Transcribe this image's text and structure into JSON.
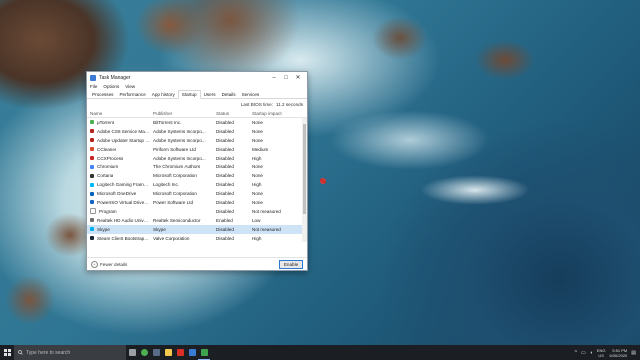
{
  "task_manager": {
    "title": "Task Manager",
    "menu": [
      "File",
      "Options",
      "View"
    ],
    "tabs": [
      "Processes",
      "Performance",
      "App history",
      "Startup",
      "Users",
      "Details",
      "Services"
    ],
    "active_tab": "Startup",
    "bios_label": "Last BIOS time:",
    "bios_value": "11.2 seconds",
    "columns": {
      "name": "Name",
      "publisher": "Publisher",
      "status": "Status",
      "impact": "Startup impact"
    },
    "rows": [
      {
        "name": "µTorrent",
        "publisher": "BitTorrent Inc.",
        "status": "Disabled",
        "impact": "None",
        "icon_color": "#4caf50"
      },
      {
        "name": "Adobe CS6 Service Manager",
        "publisher": "Adobe Systems Incorpo...",
        "status": "Disabled",
        "impact": "None",
        "icon_color": "#b3261e"
      },
      {
        "name": "Adobe Updater Startup Utility",
        "publisher": "Adobe Systems Incorpo...",
        "status": "Disabled",
        "impact": "None",
        "icon_color": "#b3261e"
      },
      {
        "name": "CCleaner",
        "publisher": "Piriform Software Ltd",
        "status": "Disabled",
        "impact": "Medium",
        "icon_color": "#d64b2c"
      },
      {
        "name": "CCXProcess",
        "publisher": "Adobe Systems Incorpo...",
        "status": "Disabled",
        "impact": "High",
        "icon_color": "#c62828"
      },
      {
        "name": "Chromium",
        "publisher": "The Chromium Authors",
        "status": "Disabled",
        "impact": "None",
        "icon_color": "#4285f4"
      },
      {
        "name": "Cortana",
        "publisher": "Microsoft Corporation",
        "status": "Disabled",
        "impact": "None",
        "icon_color": "#333333"
      },
      {
        "name": "Logitech Gaming Framework",
        "publisher": "Logitech Inc.",
        "status": "Disabled",
        "impact": "High",
        "icon_color": "#00b8fc"
      },
      {
        "name": "Microsoft OneDrive",
        "publisher": "Microsoft Corporation",
        "status": "Disabled",
        "impact": "None",
        "icon_color": "#0364b8"
      },
      {
        "name": "PowerISO Virtual Drive Man...",
        "publisher": "Power Software Ltd",
        "status": "Disabled",
        "impact": "None",
        "icon_color": "#1565c0"
      },
      {
        "name": "Program",
        "publisher": "",
        "status": "Disabled",
        "impact": "Not measured",
        "icon_color": "#ffffff"
      },
      {
        "name": "Realtek HD Audio Universal ...",
        "publisher": "Realtek Semiconductor",
        "status": "Enabled",
        "impact": "Low",
        "icon_color": "#6d6d6d"
      },
      {
        "name": "Skype",
        "publisher": "Skype",
        "status": "Disabled",
        "impact": "Not measured",
        "icon_color": "#00aff0"
      },
      {
        "name": "Steam Client Bootstrapper",
        "publisher": "Valve Corporation",
        "status": "Disabled",
        "impact": "High",
        "icon_color": "#1b2838"
      }
    ],
    "selected_row": "Skype",
    "fewer_details": "Fewer details",
    "enable_button": "Enable"
  },
  "taskbar": {
    "search_placeholder": "Type here to search",
    "pinned": [
      {
        "name": "task-view-icon",
        "color": "#9aa0a6"
      },
      {
        "name": "chrome-icon",
        "color": "#4caf50"
      },
      {
        "name": "steam-icon",
        "color": "#5a6b85"
      },
      {
        "name": "file-explorer-icon",
        "color": "#f2c94c"
      },
      {
        "name": "media-player-icon",
        "color": "#d93025"
      },
      {
        "name": "photos-icon",
        "color": "#3a7bd5"
      },
      {
        "name": "task-manager-icon",
        "color": "#3fa34d"
      }
    ],
    "lang_top": "ENG",
    "lang_bottom": "US",
    "time": "5:51 PM",
    "date": "6/30/2020"
  }
}
